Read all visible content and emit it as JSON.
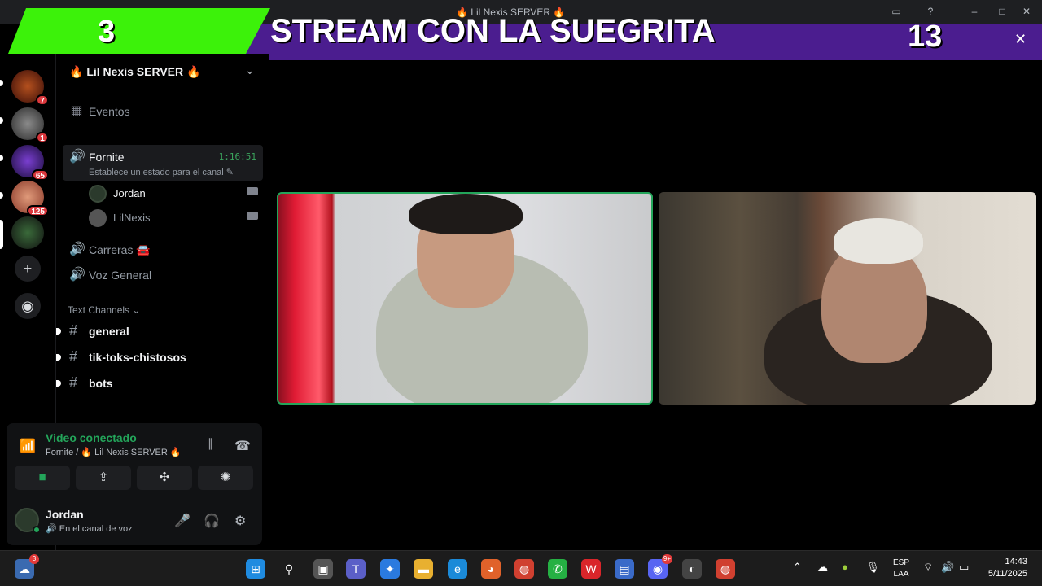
{
  "window": {
    "title": "🔥 Lil Nexis SERVER 🔥"
  },
  "overlay": {
    "left_score": "3",
    "title": "STREAM CON LA SUEGRITA",
    "right_score": "13",
    "close_glyph": "✕",
    "colors": {
      "green": "#3cf20a",
      "purple": "#4b1d8f"
    }
  },
  "servers": [
    {
      "name": "server-1",
      "badge": "7"
    },
    {
      "name": "server-2",
      "badge": "1"
    },
    {
      "name": "server-3",
      "badge": "65"
    },
    {
      "name": "server-4",
      "badge": "125"
    },
    {
      "name": "server-5",
      "badge": ""
    }
  ],
  "rail": {
    "add_glyph": "+",
    "explore_glyph": "◉"
  },
  "sidebar": {
    "server_name": "🔥 Lil Nexis SERVER 🔥",
    "events_label": "Eventos",
    "voice_channels": [
      {
        "label": "Fornite",
        "timer": "1:16:51",
        "status": "Establece un estado para el canal ✎"
      },
      {
        "label": "Carreras 🚘"
      },
      {
        "label": "Voz General"
      }
    ],
    "members": [
      {
        "name": "Jordan",
        "color": "#f2f3f5"
      },
      {
        "name": "LilNexis",
        "color": "#949ba4"
      }
    ],
    "text_category": "Text Channels ⌄",
    "text_channels": [
      "general",
      "tik-toks-chistosos",
      "bots"
    ]
  },
  "voice_panel": {
    "title": "Video conectado",
    "subtitle": "Fornite / 🔥 Lil Nexis SERVER 🔥",
    "accent": "#23a55a"
  },
  "user": {
    "name": "Jordan",
    "status": "🔊 En el canal de voz"
  },
  "taskbar": {
    "weather_badge": "3",
    "discord_badge": "9+",
    "lang_top": "ESP",
    "lang_bottom": "LAA",
    "time": "14:43",
    "date": "5/11/2025"
  }
}
